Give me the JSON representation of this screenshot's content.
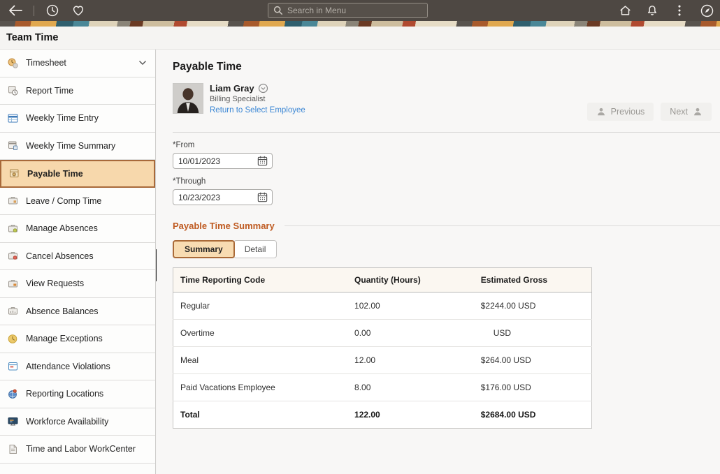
{
  "topbar": {
    "search_placeholder": "Search in Menu"
  },
  "page_title": "Team Time",
  "sidebar": {
    "items": [
      {
        "label": "Timesheet",
        "icon": "timesheet-icon",
        "selected": false,
        "chevron": true
      },
      {
        "label": "Report Time",
        "icon": "report-time-icon",
        "selected": false,
        "chevron": false
      },
      {
        "label": "Weekly Time Entry",
        "icon": "weekly-time-entry-icon",
        "selected": false,
        "chevron": false
      },
      {
        "label": "Weekly Time Summary",
        "icon": "weekly-time-summary-icon",
        "selected": false,
        "chevron": false
      },
      {
        "label": "Payable Time",
        "icon": "payable-time-icon",
        "selected": true,
        "chevron": false
      },
      {
        "label": "Leave / Comp Time",
        "icon": "leave-comp-time-icon",
        "selected": false,
        "chevron": false
      },
      {
        "label": "Manage Absences",
        "icon": "manage-absences-icon",
        "selected": false,
        "chevron": false
      },
      {
        "label": "Cancel Absences",
        "icon": "cancel-absences-icon",
        "selected": false,
        "chevron": false
      },
      {
        "label": "View Requests",
        "icon": "view-requests-icon",
        "selected": false,
        "chevron": false
      },
      {
        "label": "Absence Balances",
        "icon": "absence-balances-icon",
        "selected": false,
        "chevron": false
      },
      {
        "label": "Manage Exceptions",
        "icon": "manage-exceptions-icon",
        "selected": false,
        "chevron": false
      },
      {
        "label": "Attendance Violations",
        "icon": "attendance-violations-icon",
        "selected": false,
        "chevron": false
      },
      {
        "label": "Reporting Locations",
        "icon": "reporting-locations-icon",
        "selected": false,
        "chevron": false
      },
      {
        "label": "Workforce Availability",
        "icon": "workforce-availability-icon",
        "selected": false,
        "chevron": false
      },
      {
        "label": "Time and Labor WorkCenter",
        "icon": "workcenter-icon",
        "selected": false,
        "chevron": false
      }
    ]
  },
  "main": {
    "title": "Payable Time",
    "employee": {
      "name": "Liam Gray",
      "role": "Billing Specialist",
      "link": "Return to Select Employee"
    },
    "pager": {
      "previous": "Previous",
      "next": "Next"
    },
    "filters": {
      "from_label": "*From",
      "from_value": "10/01/2023",
      "through_label": "*Through",
      "through_value": "10/23/2023"
    },
    "summary": {
      "heading": "Payable Time Summary",
      "tabs": {
        "summary": "Summary",
        "detail": "Detail"
      },
      "active_tab": "Summary",
      "table": {
        "columns": [
          "Time Reporting Code",
          "Quantity (Hours)",
          "Estimated Gross"
        ],
        "rows": [
          [
            "Regular",
            "102.00",
            "$2244.00 USD"
          ],
          [
            "Overtime",
            "0.00",
            "USD"
          ],
          [
            "Meal",
            "12.00",
            "$264.00 USD"
          ],
          [
            "Paid Vacations Employee",
            "8.00",
            "$176.00 USD"
          ]
        ],
        "total_row": [
          "Total",
          "122.00",
          "$2684.00 USD"
        ]
      }
    }
  },
  "colors": {
    "topbar_bg": "#4e4843",
    "selected_item_bg": "#f7d8ac",
    "selected_item_border": "#a8693a",
    "section_heading": "#bf5b22",
    "link": "#3a86d4",
    "active_tab_bg": "#f8dcb2"
  }
}
